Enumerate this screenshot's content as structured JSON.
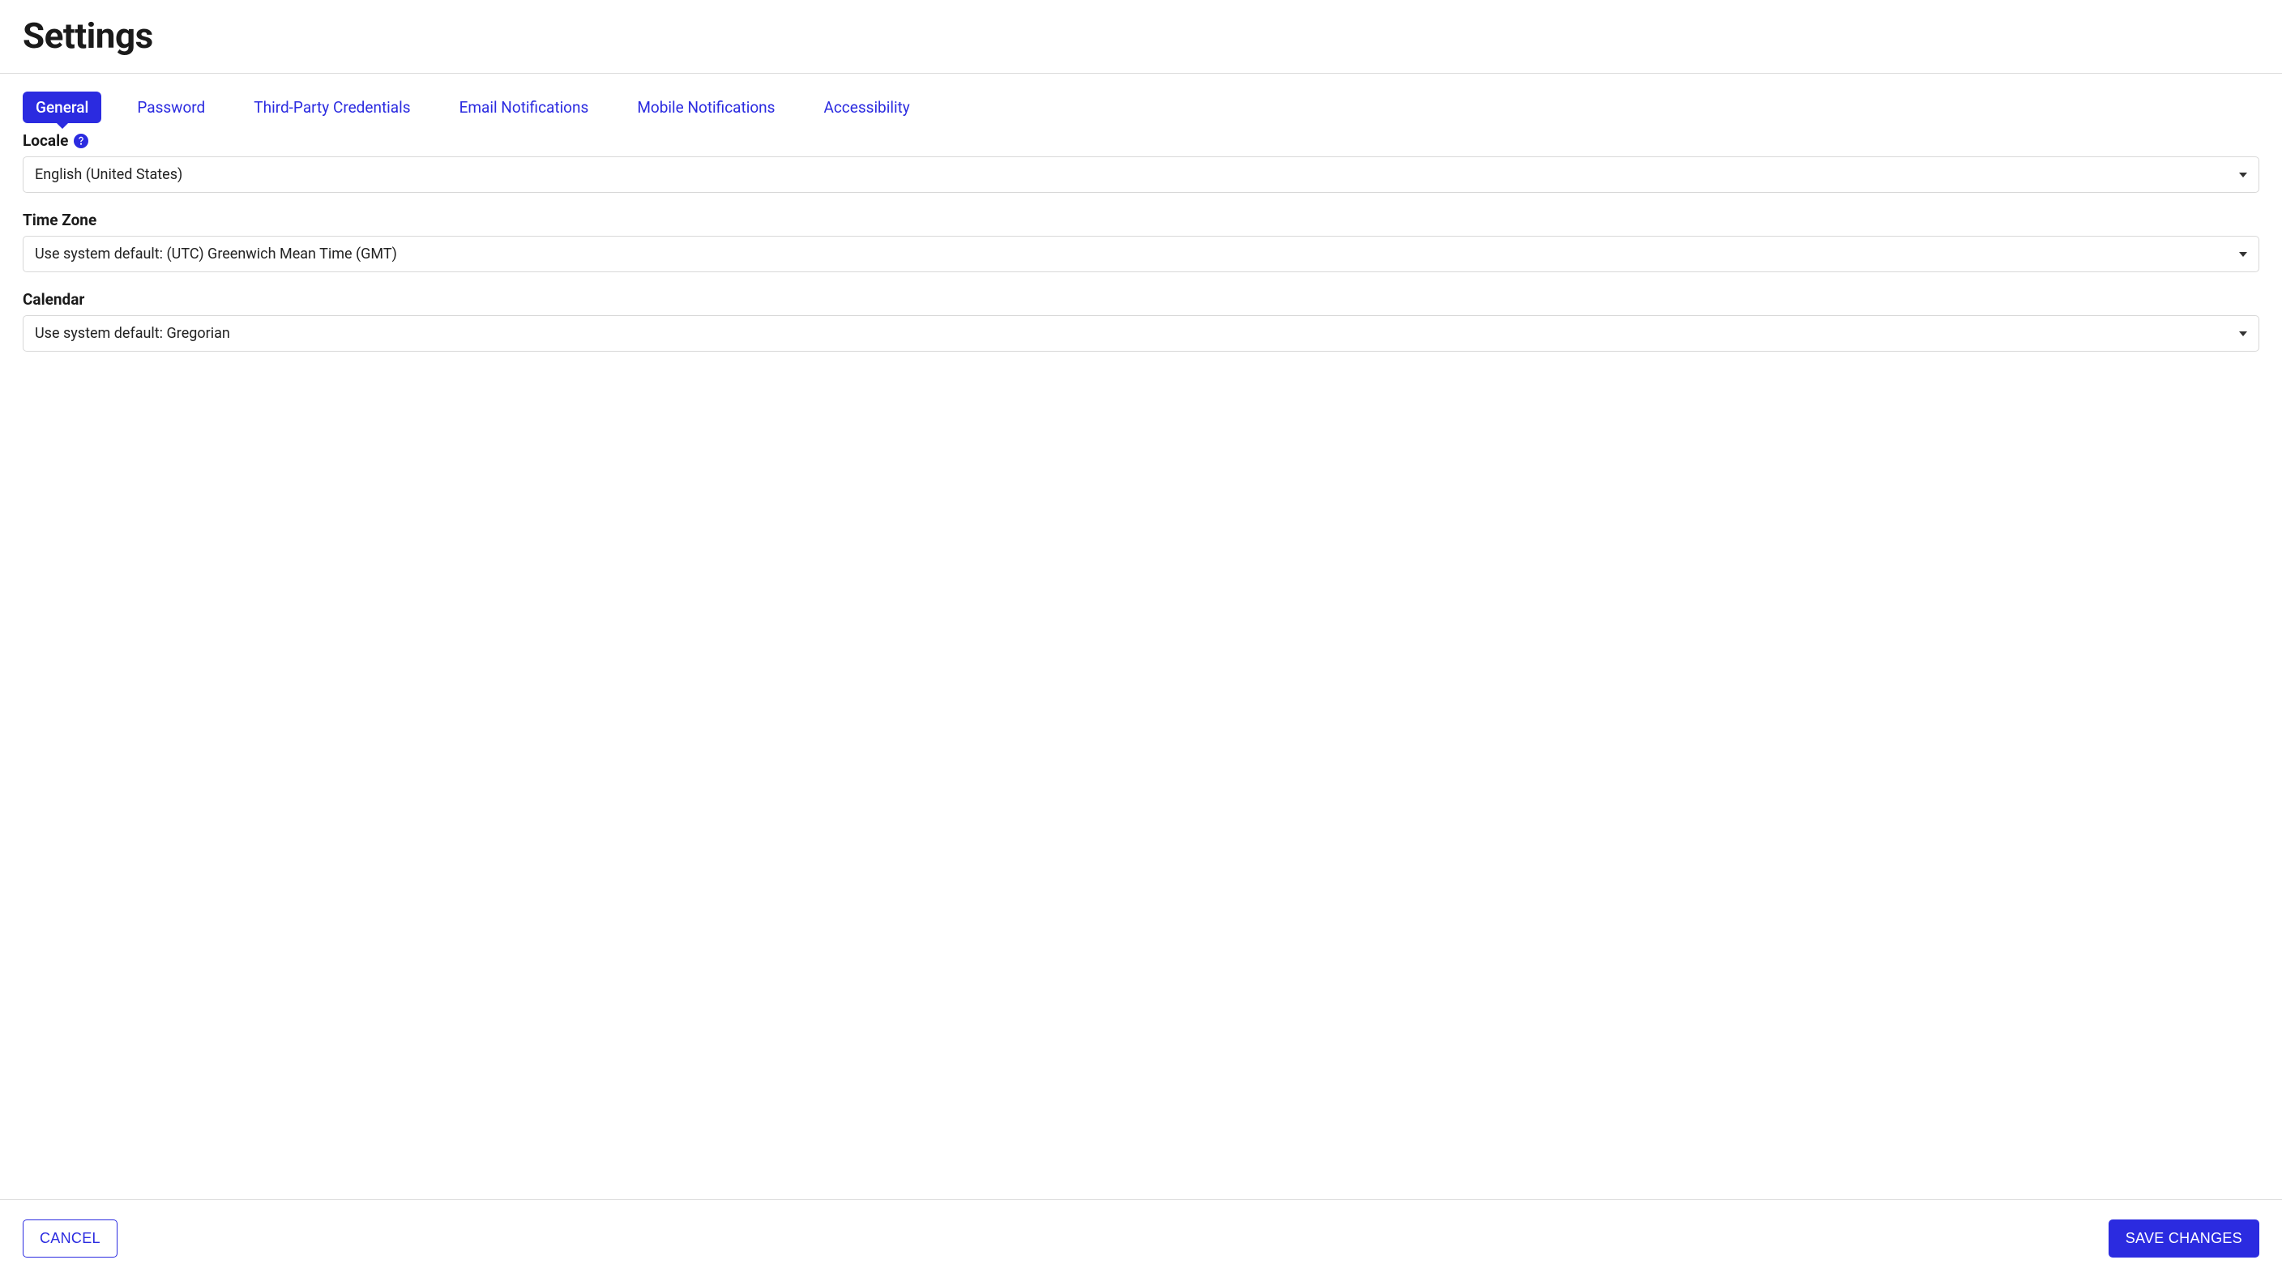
{
  "page": {
    "title": "Settings"
  },
  "tabs": [
    {
      "label": "General",
      "active": true
    },
    {
      "label": "Password",
      "active": false
    },
    {
      "label": "Third-Party Credentials",
      "active": false
    },
    {
      "label": "Email Notifications",
      "active": false
    },
    {
      "label": "Mobile Notifications",
      "active": false
    },
    {
      "label": "Accessibility",
      "active": false
    }
  ],
  "form": {
    "locale": {
      "label": "Locale",
      "value": "English (United States)"
    },
    "timezone": {
      "label": "Time Zone",
      "value": "Use system default: (UTC) Greenwich Mean Time (GMT)"
    },
    "calendar": {
      "label": "Calendar",
      "value": "Use system default: Gregorian"
    }
  },
  "footer": {
    "cancel_label": "CANCEL",
    "save_label": "SAVE CHANGES"
  }
}
